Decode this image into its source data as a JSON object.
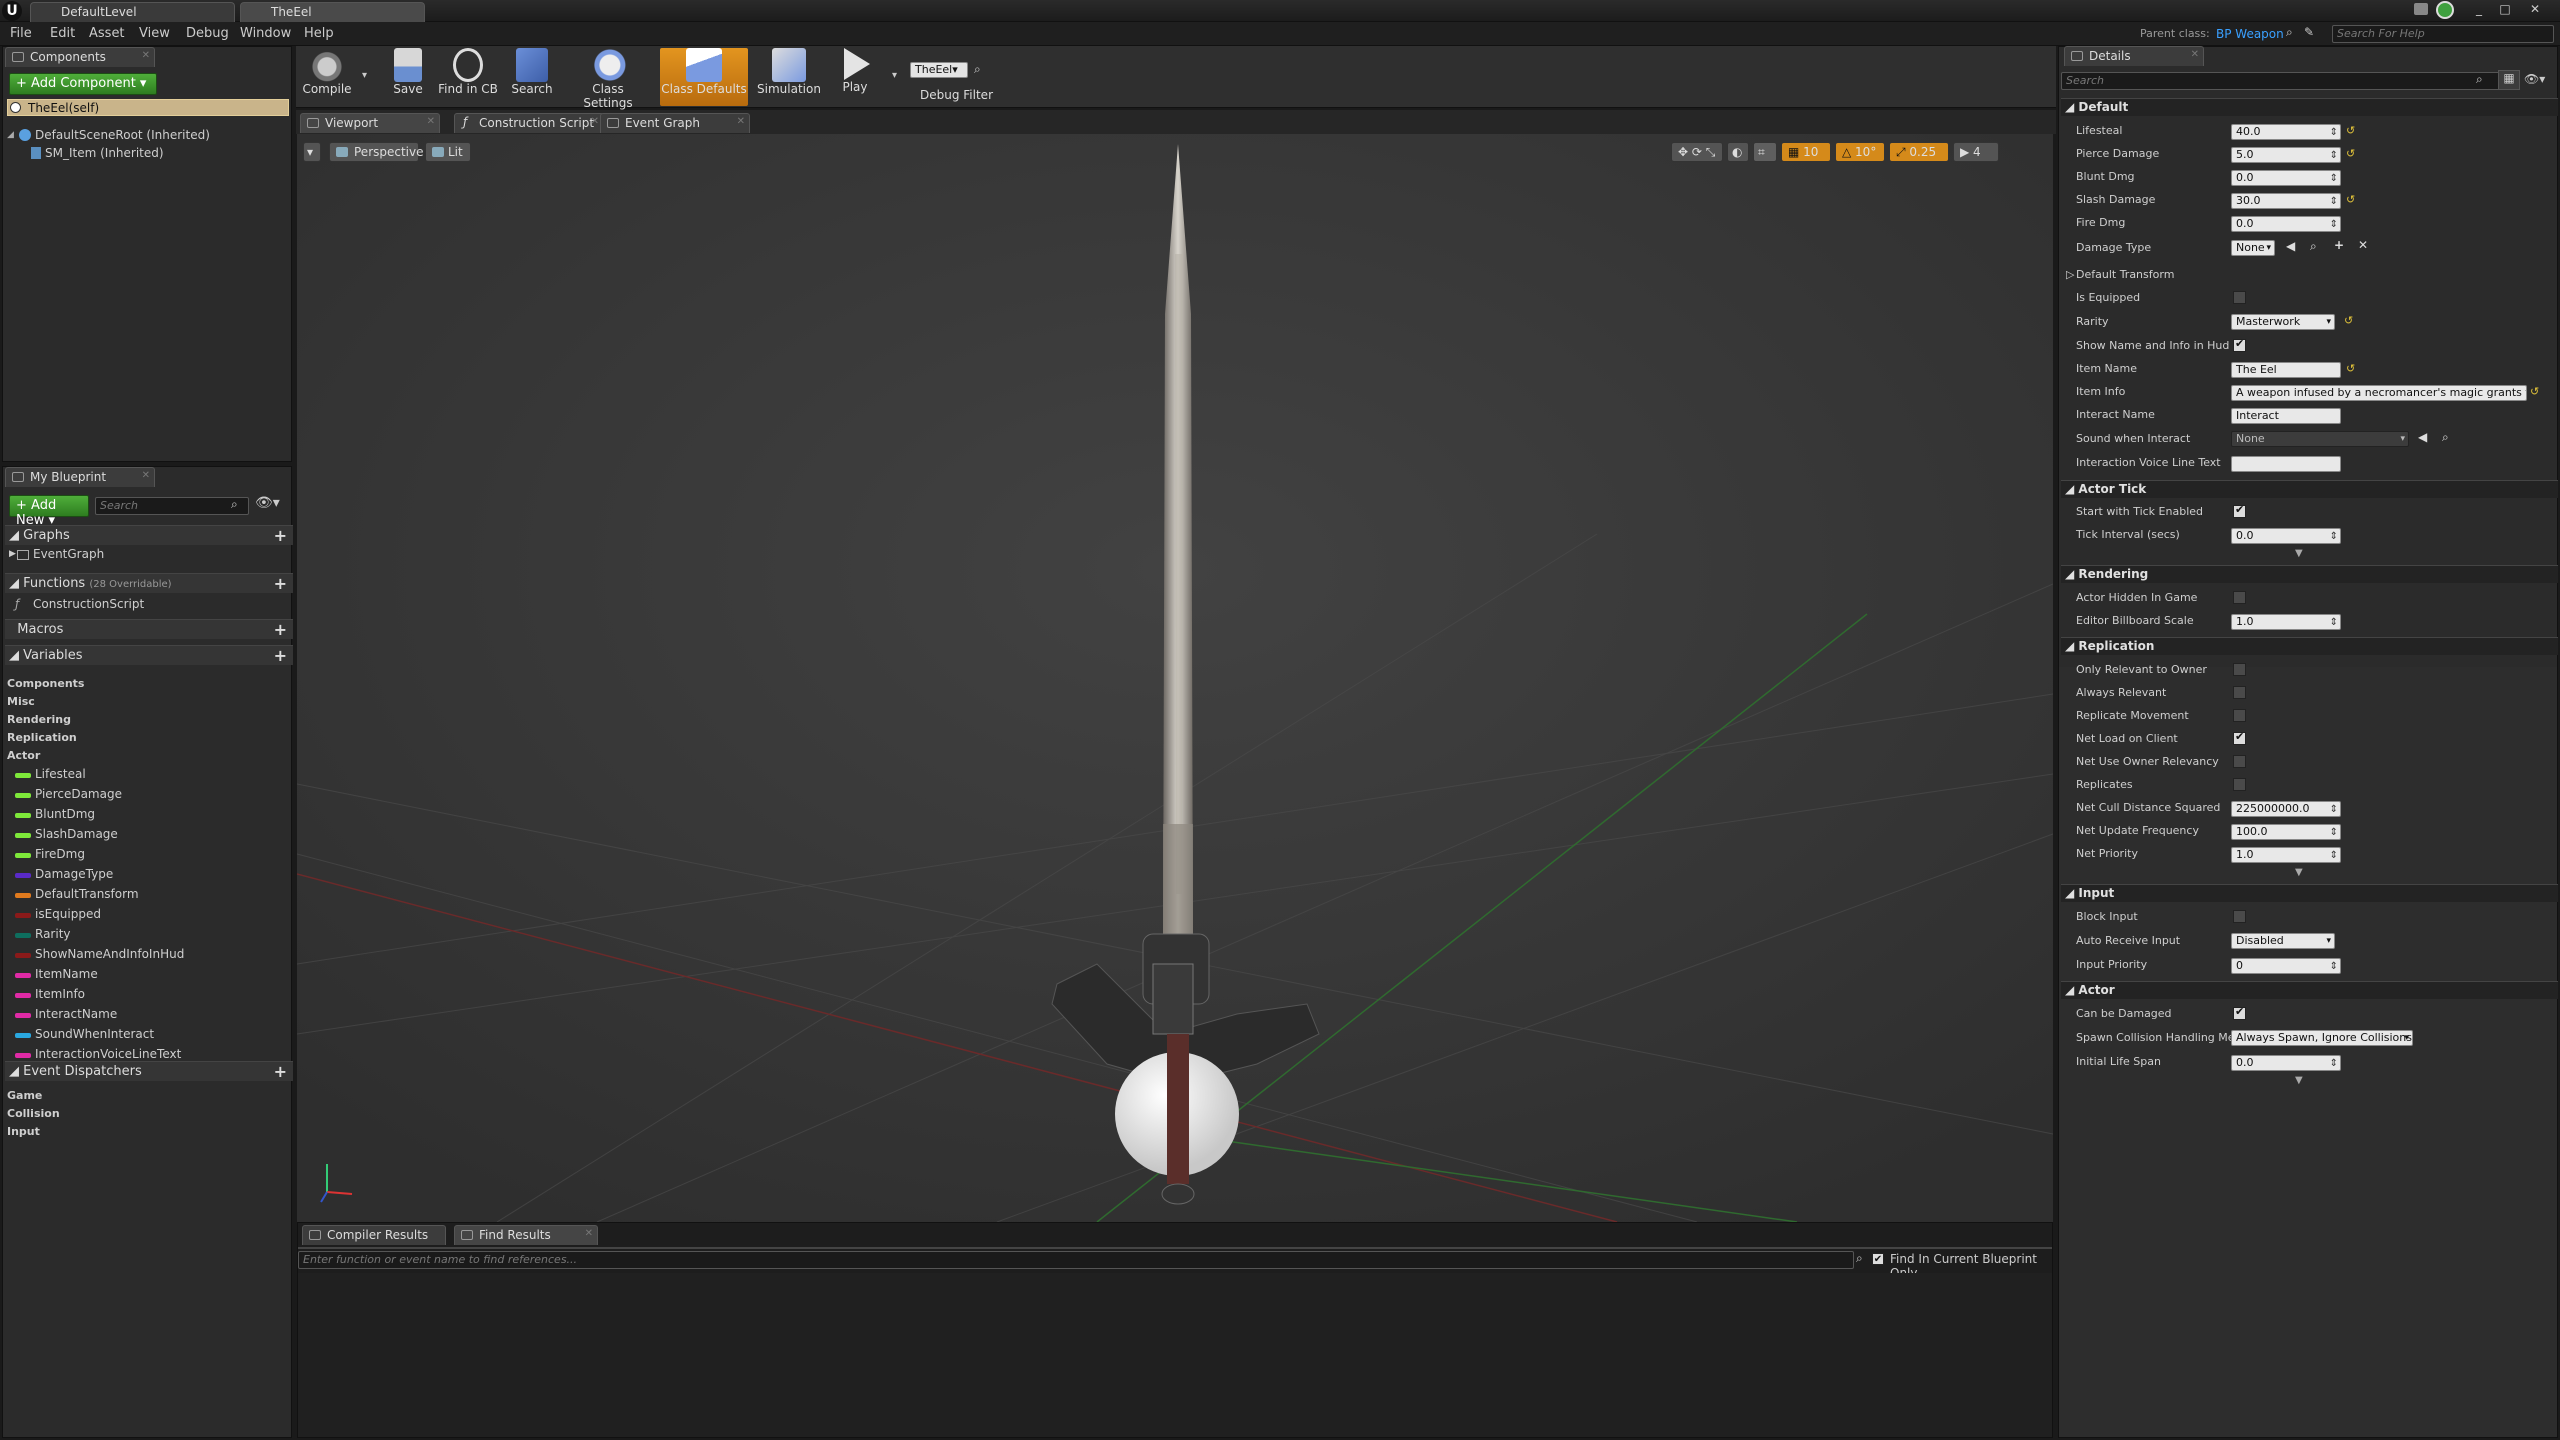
{
  "titlebar": {
    "tabs": [
      "DefaultLevel",
      "TheEel"
    ],
    "window_buttons": [
      "_",
      "□",
      "✕"
    ]
  },
  "menubar": {
    "items": [
      "File",
      "Edit",
      "Asset",
      "View",
      "Debug",
      "Window",
      "Help"
    ],
    "parent_class_label": "Parent class:",
    "parent_class_value": "BP Weapon",
    "search_help_placeholder": "Search For Help"
  },
  "components_panel": {
    "tab": "Components",
    "add_button": "+ Add Component ▾",
    "self_item": "TheEel(self)",
    "tree": [
      "DefaultSceneRoot (Inherited)",
      "SM_Item (Inherited)"
    ]
  },
  "toolbar": {
    "buttons": [
      "Compile",
      "Save",
      "Find in CB",
      "Search",
      "Class Settings",
      "Class Defaults",
      "Simulation",
      "Play"
    ],
    "debug_combo": "TheEel▾",
    "debug_filter_label": "Debug Filter"
  },
  "my_blueprint": {
    "tab": "My Blueprint",
    "add_new": "+ Add New ▾",
    "search_placeholder": "Search",
    "graphs_header": "Graphs",
    "graphs": [
      "EventGraph"
    ],
    "functions_header": "Functions",
    "functions_count": "(28 Overridable)",
    "functions": [
      "ConstructionScript"
    ],
    "macros_header": "Macros",
    "variables_header": "Variables",
    "var_categories": [
      "Components",
      "Misc",
      "Rendering",
      "Replication",
      "Actor"
    ],
    "variables": [
      {
        "name": "Lifesteal",
        "color": "#7ee83a"
      },
      {
        "name": "PierceDamage",
        "color": "#7ee83a"
      },
      {
        "name": "BluntDmg",
        "color": "#7ee83a"
      },
      {
        "name": "SlashDamage",
        "color": "#7ee83a"
      },
      {
        "name": "FireDmg",
        "color": "#7ee83a"
      },
      {
        "name": "DamageType",
        "color": "#5a2ac8"
      },
      {
        "name": "DefaultTransform",
        "color": "#e07a1e"
      },
      {
        "name": "isEquipped",
        "color": "#8a1a1a"
      },
      {
        "name": "Rarity",
        "color": "#0e6e5e"
      },
      {
        "name": "ShowNameAndInfoInHud",
        "color": "#8a1a1a"
      },
      {
        "name": "ItemName",
        "color": "#e02aa6"
      },
      {
        "name": "ItemInfo",
        "color": "#e02aa6"
      },
      {
        "name": "InteractName",
        "color": "#e02aa6"
      },
      {
        "name": "SoundWhenInteract",
        "color": "#2aa8e0"
      },
      {
        "name": "InteractionVoiceLineText",
        "color": "#e02aa6"
      }
    ],
    "dispatchers_header": "Event Dispatchers",
    "dispatcher_categories": [
      "Game",
      "Collision",
      "Input"
    ]
  },
  "editor_tabs": [
    "Viewport",
    "Construction Script",
    "Event Graph"
  ],
  "viewport": {
    "perspective": "Perspective",
    "lit": "Lit",
    "grid_snap": "10",
    "rot_snap": "10°",
    "scale_snap": "0.25",
    "cam_speed": "4"
  },
  "bottom": {
    "tabs": [
      "Compiler Results",
      "Find Results"
    ],
    "find_placeholder": "Enter function or event name to find references...",
    "find_current_label": "Find In Current Blueprint Only"
  },
  "details": {
    "tab": "Details",
    "search_placeholder": "Search",
    "sections": {
      "default": "Default",
      "actor_tick": "Actor Tick",
      "rendering": "Rendering",
      "replication": "Replication",
      "input": "Input",
      "actor": "Actor"
    },
    "default_props": {
      "lifesteal_label": "Lifesteal",
      "lifesteal": "40.0",
      "pierce_label": "Pierce Damage",
      "pierce": "5.0",
      "blunt_label": "Blunt Dmg",
      "blunt": "0.0",
      "slash_label": "Slash Damage",
      "slash": "30.0",
      "fire_label": "Fire Dmg",
      "fire": "0.0",
      "damage_type_label": "Damage Type",
      "damage_type": "None",
      "default_transform_label": "Default Transform",
      "is_equipped_label": "Is Equipped",
      "rarity_label": "Rarity",
      "rarity": "Masterwork",
      "show_name_label": "Show Name and Info in Hud",
      "item_name_label": "Item Name",
      "item_name": "The Eel",
      "item_info_label": "Item Info",
      "item_info": "A weapon infused by a necromancer's magic grants the u",
      "interact_name_label": "Interact Name",
      "interact_name": "Interact",
      "sound_label": "Sound when Interact",
      "sound": "None",
      "voice_label": "Interaction Voice Line Text",
      "voice": ""
    },
    "tick_props": {
      "start_label": "Start with Tick Enabled",
      "interval_label": "Tick Interval (secs)",
      "interval": "0.0"
    },
    "rendering_props": {
      "hidden_label": "Actor Hidden In Game",
      "billboard_label": "Editor Billboard Scale",
      "billboard": "1.0"
    },
    "replication_props": {
      "only_relevant_label": "Only Relevant to Owner",
      "always_relevant_label": "Always Relevant",
      "replicate_movement_label": "Replicate Movement",
      "net_load_label": "Net Load on Client",
      "net_use_owner_label": "Net Use Owner Relevancy",
      "replicates_label": "Replicates",
      "cull_label": "Net Cull Distance Squared",
      "cull": "225000000.0",
      "update_label": "Net Update Frequency",
      "update": "100.0",
      "priority_label": "Net Priority",
      "priority": "1.0"
    },
    "input_props": {
      "block_label": "Block Input",
      "auto_label": "Auto Receive Input",
      "auto": "Disabled",
      "priority_label": "Input Priority",
      "priority": "0"
    },
    "actor_props": {
      "damaged_label": "Can be Damaged",
      "spawn_label": "Spawn Collision Handling Met",
      "spawn": "Always Spawn, Ignore Collisions",
      "lifespan_label": "Initial Life Span",
      "lifespan": "0.0"
    }
  }
}
